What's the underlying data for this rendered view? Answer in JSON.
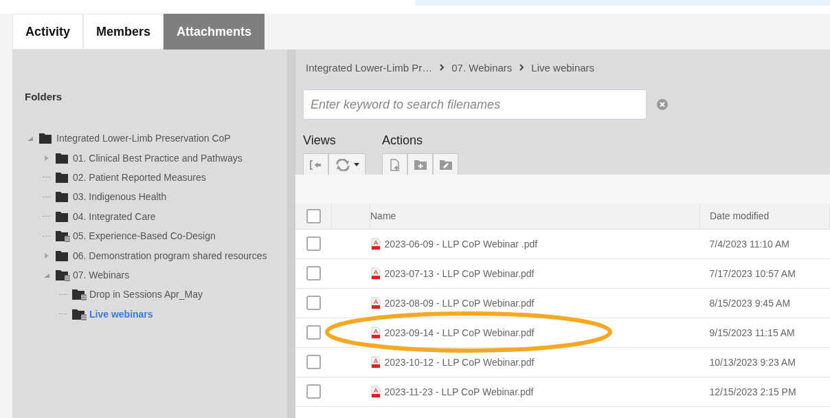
{
  "tabs": [
    {
      "label": "Activity",
      "selected": false
    },
    {
      "label": "Members",
      "selected": false
    },
    {
      "label": "Attachments",
      "selected": true
    }
  ],
  "folders": {
    "title": "Folders",
    "tree": [
      {
        "label": "Integrated Lower-Limb Preservation CoP",
        "kind": "plain",
        "expanded": true,
        "selected": false,
        "children": [
          {
            "label": "01. Clinical Best Practice and Pathways",
            "kind": "plain",
            "expanded": false,
            "selected": false
          },
          {
            "label": "02. Patient Reported Measures",
            "kind": "plain",
            "selected": false
          },
          {
            "label": "03. Indigenous Health",
            "kind": "plain",
            "selected": false
          },
          {
            "label": "04. Integrated Care",
            "kind": "plain",
            "selected": false
          },
          {
            "label": "05. Experience-Based Co-Design",
            "kind": "stacked",
            "selected": false
          },
          {
            "label": "06. Demonstration program shared resources",
            "kind": "plain",
            "expanded": false,
            "selected": false
          },
          {
            "label": "07. Webinars",
            "kind": "stacked",
            "expanded": true,
            "selected": false,
            "children": [
              {
                "label": "Drop in Sessions Apr_May",
                "kind": "stacked",
                "selected": false
              },
              {
                "label": "Live webinars",
                "kind": "stacked",
                "selected": true
              }
            ]
          }
        ]
      }
    ]
  },
  "breadcrumb": [
    "Integrated Lower-Limb Pr…",
    "07. Webinars",
    "Live webinars"
  ],
  "search": {
    "placeholder": "Enter keyword to search filenames"
  },
  "toolbar": {
    "views_label": "Views",
    "actions_label": "Actions"
  },
  "table": {
    "columns": [
      "Name",
      "Date modified"
    ],
    "header_checked": false,
    "rows": [
      {
        "name": "2023-06-09 - LLP CoP Webinar .pdf",
        "date": "7/4/2023 11:10 AM",
        "checked": false
      },
      {
        "name": "2023-07-13 - LLP CoP Webinar.pdf",
        "date": "7/17/2023 10:57 AM",
        "checked": false
      },
      {
        "name": "2023-08-09 - LLP CoP Webinar.pdf",
        "date": "8/15/2023 9:45 AM",
        "checked": false
      },
      {
        "name": "2023-09-14 - LLP CoP Webinar.pdf",
        "date": "9/15/2023 11:15 AM",
        "checked": false
      },
      {
        "name": "2023-10-12 - LLP CoP Webinar.pdf",
        "date": "10/13/2023 9:23 AM",
        "checked": false
      },
      {
        "name": "2023-11-23 - LLP CoP Webinar.pdf",
        "date": "12/15/2023 2:15 PM",
        "checked": false
      }
    ]
  },
  "annotation": {
    "kind": "ellipse"
  }
}
